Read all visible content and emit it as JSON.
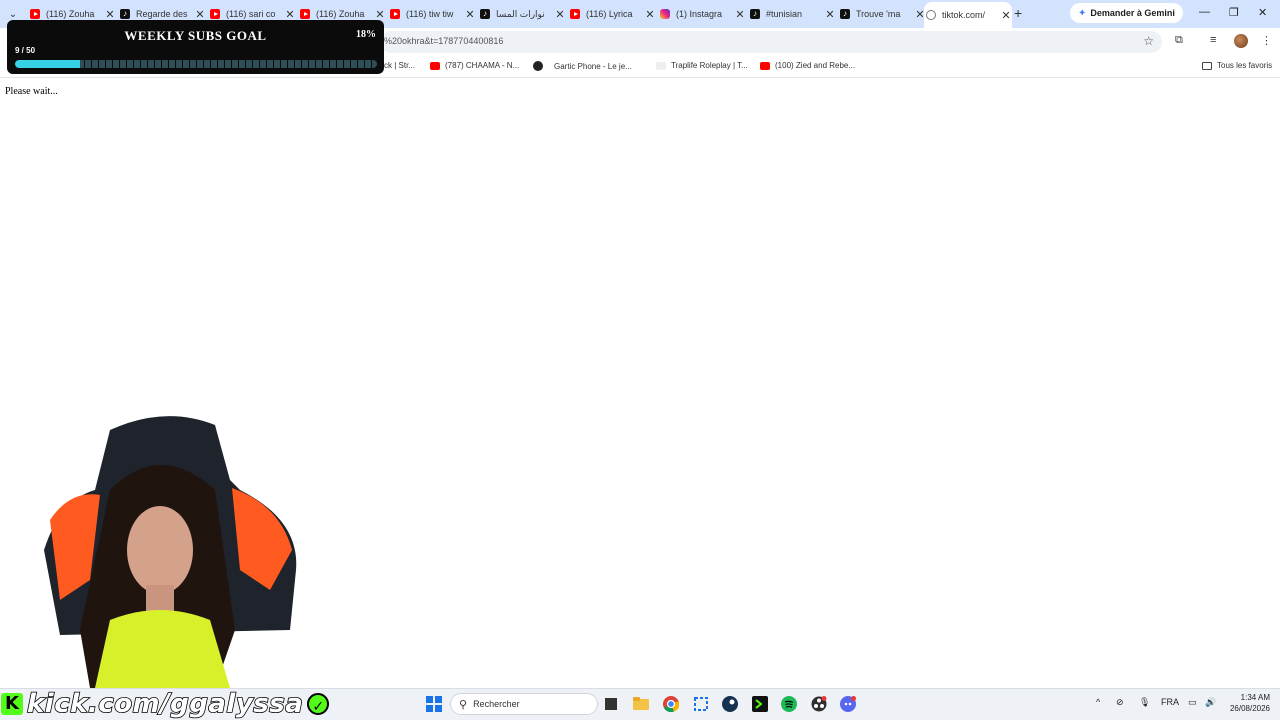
{
  "browser": {
    "tabs": [
      {
        "label": "(116) Zouha",
        "favicon": "youtube-icon"
      },
      {
        "label": "Regarde des",
        "favicon": "tiktok-icon"
      },
      {
        "label": "(116) sari co",
        "favicon": "youtube-icon"
      },
      {
        "label": "(116) Zouha",
        "favicon": "youtube-icon"
      },
      {
        "label": "(116) tiw tiw",
        "favicon": "youtube-icon"
      },
      {
        "label": "نوارات المسا",
        "favicon": "tiktok-icon"
      },
      {
        "label": "(116) Lyrica",
        "favicon": "youtube-icon"
      },
      {
        "label": "(1) Instagra",
        "favicon": "instagram-icon"
      },
      {
        "label": "#tunisian",
        "favicon": "tiktok-icon"
      },
      {
        "label": "Trouve 'ma",
        "favicon": "tiktok-icon"
      },
      {
        "label": "tiktok.com/",
        "favicon": "globe-icon",
        "active": true
      }
    ],
    "new_tab_symbol": "+",
    "gemini_label": "Demander à Gemini",
    "url": "%20okhra&t=1787704400816",
    "bookmarks": [
      {
        "label": "ck | Str..."
      },
      {
        "label": "(787) CHAAMA - N..."
      },
      {
        "label": "Gartic Phone - Le je..."
      },
      {
        "label": "Traplife Roleplay | T..."
      },
      {
        "label": "(100) Zied and Rebe..."
      }
    ],
    "all_bookmarks_label": "Tous les favoris"
  },
  "page": {
    "body_text": "Please wait..."
  },
  "goal_widget": {
    "title": "WEEKLY SUBS GOAL",
    "percent_label": "18%",
    "count_label": "9 / 50",
    "progress_fraction": 0.18,
    "fill_color": "#36d3e6"
  },
  "overlay": {
    "kick_logo_letter": "K",
    "kick_text": "kick.com/ggalyssa",
    "brand_color": "#53fc18"
  },
  "taskbar": {
    "search_placeholder": "Rechercher",
    "language": "FRA",
    "time": "1:34 AM",
    "date": "26/08/2026"
  }
}
